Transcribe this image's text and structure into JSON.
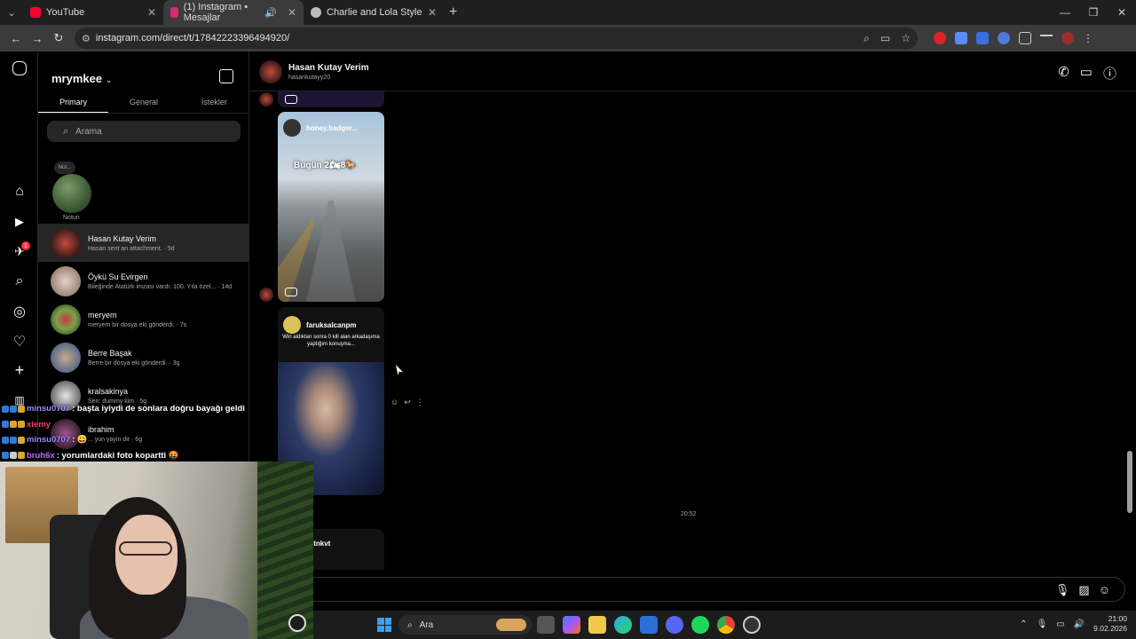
{
  "browser": {
    "tabs": [
      {
        "title": "YouTube",
        "favicon_color": "#ff0033"
      },
      {
        "title": "(1) Instagram • Mesajlar",
        "favicon_color": "#d62976",
        "active": true
      },
      {
        "title": "Charlie and Lola Style",
        "favicon_color": "#bbbbbb"
      }
    ],
    "url": "instagram.com/direct/t/17842223396494920/"
  },
  "sidebar": {
    "username": "mrymkee",
    "tabs": [
      "Primary",
      "General",
      "İstekler"
    ],
    "search_placeholder": "Arama",
    "note_bubble": "Not...",
    "note_label": "Notun",
    "notification_badge": "1",
    "conversations": [
      {
        "name": "Hasan Kutay Verim",
        "preview": "Hasan sent an attachment. · 5d",
        "avatar": "#8c2a25"
      },
      {
        "name": "Öykü Su Evirgen",
        "preview": "Bileğinde Atatürk imzası vardı: 100. Yıla özel... · 14d",
        "avatar": "#cdb9ae"
      },
      {
        "name": "meryem",
        "preview": "meryem bir dosya eki gönderdi. · 7s",
        "avatar": "#5e8a3e"
      },
      {
        "name": "Berre Başak",
        "preview": "Berre bir dosya eki gönderdi. · 3g",
        "avatar": "#8a93a8"
      },
      {
        "name": "kralsakinya",
        "preview": "Sen: dummy kim · 5g",
        "avatar": "#d0d0d0"
      },
      {
        "name": "ibrahim",
        "preview": "... yun yayin dir · 6g",
        "avatar": "#6a3b5a"
      }
    ]
  },
  "chat": {
    "name": "Hasan Kutay Verim",
    "handle": "hasankutayy20",
    "reel1": {
      "account": "honey.badger...",
      "sticker": "Bugün 2🏍8🐎"
    },
    "reel2": {
      "account": "faruksalcanpm",
      "caption": "Win aldıktan sonra 0 kill alan arkadaşıma yaptığım konuşma..."
    },
    "reel3": {
      "account": "itnkvt"
    },
    "timestamp": "20:52"
  },
  "stream_chat": [
    {
      "user": "minsu0707",
      "message": ": başta iyiydi de sonlara doğru bayağı geldi",
      "color": "#9b8cff"
    },
    {
      "user": "xiemy",
      "message": "",
      "color": "#ff3b6b"
    },
    {
      "user": "minsu0707",
      "message": ": 😀",
      "color": "#9b8cff"
    },
    {
      "user": "bruh6x",
      "message": ": yorumlardaki foto kopartti 🤬",
      "color": "#c36bff"
    }
  ],
  "taskbar": {
    "search_label": "Ara",
    "time": "21:00",
    "date": "9.02.2026"
  }
}
